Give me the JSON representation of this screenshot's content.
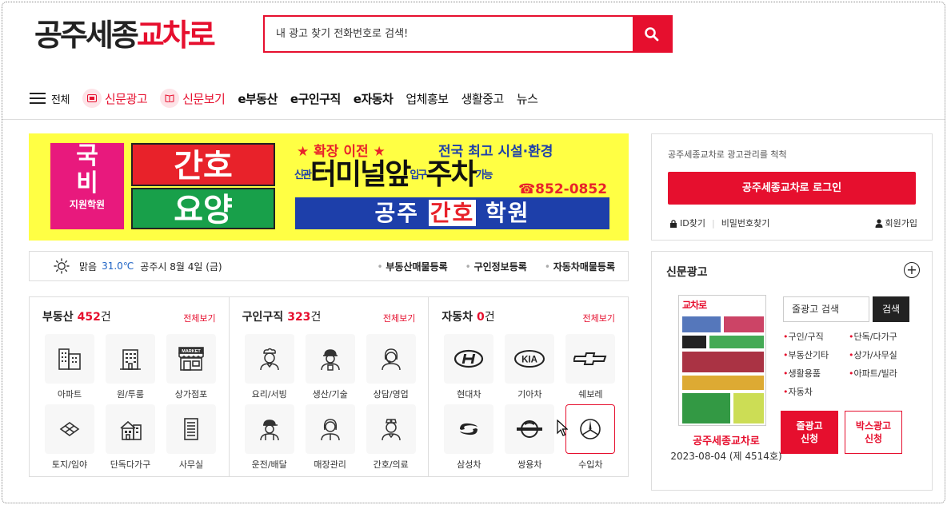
{
  "header": {
    "logo_part1": "공주세종",
    "logo_part2": "교차로",
    "search_placeholder": "내 광고 찾기 전화번호로 검색!"
  },
  "nav": {
    "all": "전체",
    "items": [
      "신문광고",
      "신문보기",
      "e부동산",
      "e구인구직",
      "e자동차",
      "업체홍보",
      "생활중고",
      "뉴스"
    ]
  },
  "banner": {
    "guk": "국",
    "bi": "비",
    "support": "지원학원",
    "gan": "간호",
    "yoyang": "요양",
    "move": "★ 확장 이전 ★",
    "facility": "전국 최고 시설·환경",
    "new": "신관",
    "terminal": "터미널앞",
    "park_note": "입구",
    "parking": "주차",
    "park_possible": "가능",
    "phone": "☎852-0852",
    "academy_1": "공주",
    "academy_2": "간호",
    "academy_3": "학원"
  },
  "weather": {
    "condition": "맑음",
    "temp": "31.0℃",
    "date": "공주시 8월 4일 (금)",
    "links": [
      "부동산매물등록",
      "구인정보등록",
      "자동차매물등록"
    ]
  },
  "categories": [
    {
      "title": "부동산",
      "count": "452",
      "unit": "건",
      "more": "전체보기",
      "tiles": [
        {
          "label": "아파트",
          "icon": "apartment-icon"
        },
        {
          "label": "원/투룸",
          "icon": "building-icon"
        },
        {
          "label": "상가점포",
          "icon": "market-icon"
        },
        {
          "label": "토지/임야",
          "icon": "land-icon"
        },
        {
          "label": "단독다가구",
          "icon": "house-icon"
        },
        {
          "label": "사무실",
          "icon": "office-icon"
        }
      ]
    },
    {
      "title": "구인구직",
      "count": "323",
      "unit": "건",
      "more": "전체보기",
      "tiles": [
        {
          "label": "요리/서빙",
          "icon": "chef-icon"
        },
        {
          "label": "생산/기술",
          "icon": "worker-icon"
        },
        {
          "label": "상담/영업",
          "icon": "consultant-icon"
        },
        {
          "label": "운전/배달",
          "icon": "driver-icon"
        },
        {
          "label": "매장관리",
          "icon": "staff-icon"
        },
        {
          "label": "간호/의료",
          "icon": "nurse-icon"
        }
      ]
    },
    {
      "title": "자동차",
      "count": "0",
      "unit": "건",
      "more": "전체보기",
      "tiles": [
        {
          "label": "현대차",
          "icon": "hyundai-icon"
        },
        {
          "label": "기아차",
          "icon": "kia-icon"
        },
        {
          "label": "쉐보레",
          "icon": "chevrolet-icon"
        },
        {
          "label": "삼성차",
          "icon": "samsung-icon"
        },
        {
          "label": "쌍용차",
          "icon": "ssangyong-icon"
        },
        {
          "label": "수입차",
          "icon": "benz-icon"
        }
      ]
    }
  ],
  "login": {
    "info": "공주세종교차로 광고관리를 척척",
    "button": "공주세종교차로 로그인",
    "find_id": "ID찾기",
    "find_pw": "비밀번호찾기",
    "join": "회원가입"
  },
  "newspaper": {
    "title": "신문광고",
    "paper_logo": "교차로",
    "name": "공주세종교차로",
    "date": "2023-08-04 (제 4514호)",
    "search_placeholder": "줄광고 검색",
    "search_button": "검색",
    "links": [
      "구인/구직",
      "단독/다가구",
      "부동산기타",
      "상가/사무실",
      "생활용품",
      "아파트/빌라",
      "자동차"
    ],
    "btn1_line1": "줄광고",
    "btn1_line2": "신청",
    "btn2_line1": "박스광고",
    "btn2_line2": "신청"
  },
  "colors": {
    "brand": "#e60f2e"
  }
}
